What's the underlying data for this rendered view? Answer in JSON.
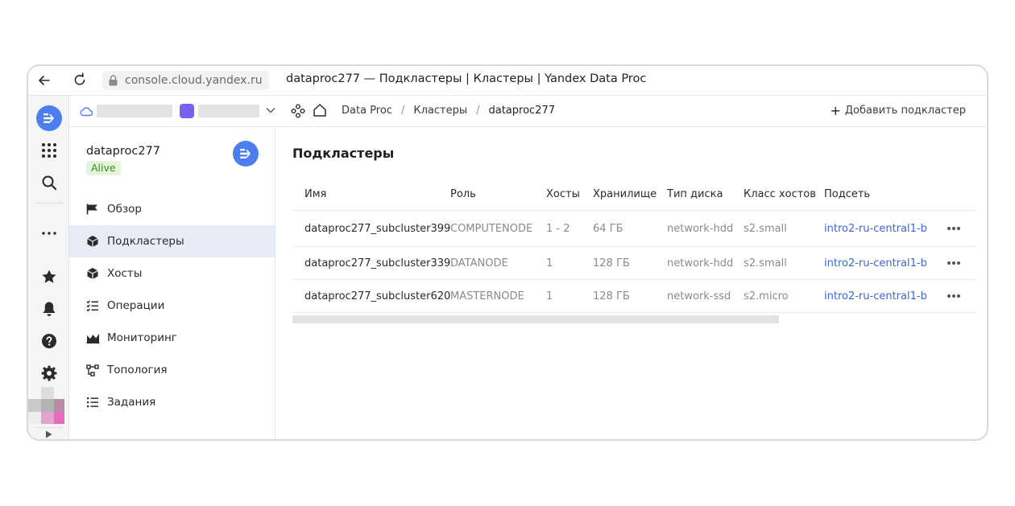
{
  "browser": {
    "url": "console.cloud.yandex.ru",
    "title": "dataproc277 — Подкластеры | Кластеры | Yandex Data Proc"
  },
  "topnav": {
    "breadcrumbs": [
      "Data Proc",
      "Кластеры",
      "dataproc277"
    ],
    "add_button": "Добавить подкластер"
  },
  "cluster": {
    "name": "dataproc277",
    "status": "Alive"
  },
  "menu": {
    "items": [
      {
        "label": "Обзор",
        "icon": "flag-icon"
      },
      {
        "label": "Подкластеры",
        "icon": "cube-icon",
        "active": true
      },
      {
        "label": "Хосты",
        "icon": "cube-icon"
      },
      {
        "label": "Операции",
        "icon": "checklist-icon"
      },
      {
        "label": "Мониторинг",
        "icon": "chart-icon"
      },
      {
        "label": "Топология",
        "icon": "topology-icon"
      },
      {
        "label": "Задания",
        "icon": "list-icon"
      }
    ]
  },
  "main": {
    "title": "Подкластеры",
    "columns": [
      "Имя",
      "Роль",
      "Хосты",
      "Хранилище",
      "Тип диска",
      "Класс хостов",
      "Подсеть"
    ],
    "rows": [
      {
        "name": "dataproc277_subcluster399",
        "role": "COMPUTENODE",
        "hosts": "1 - 2",
        "storage": "64 ГБ",
        "disk": "network-hdd",
        "class": "s2.small",
        "subnet": "intro2-ru-central1-b"
      },
      {
        "name": "dataproc277_subcluster339",
        "role": "DATANODE",
        "hosts": "1",
        "storage": "128 ГБ",
        "disk": "network-hdd",
        "class": "s2.small",
        "subnet": "intro2-ru-central1-b"
      },
      {
        "name": "dataproc277_subcluster620",
        "role": "MASTERNODE",
        "hosts": "1",
        "storage": "128 ГБ",
        "disk": "network-ssd",
        "class": "s2.micro",
        "subnet": "intro2-ru-central1-b"
      }
    ]
  },
  "colors": {
    "accent": "#4d7ef0",
    "link": "#3a66d8",
    "active_menu_bg": "#e8ecf6",
    "alive_bg": "#e6f4dc",
    "alive_text": "#3a8a19"
  }
}
